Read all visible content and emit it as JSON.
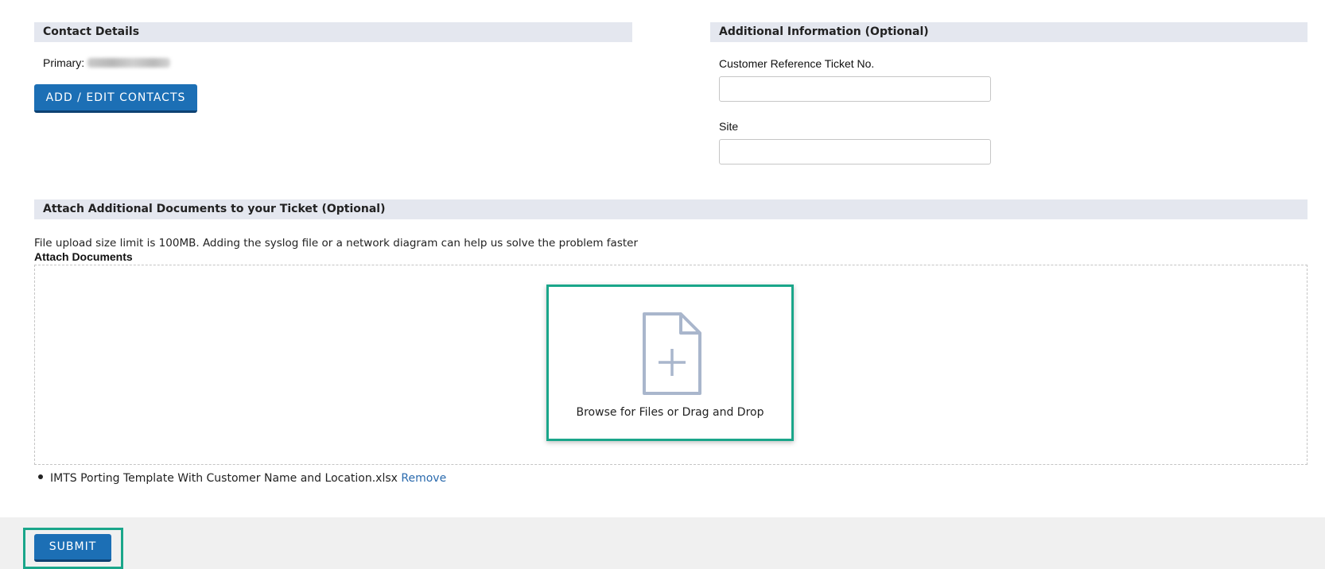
{
  "contact_details": {
    "title": "Contact Details",
    "primary_label": "Primary:",
    "add_edit_button": "ADD / EDIT CONTACTS"
  },
  "additional_info": {
    "title": "Additional Information (Optional)",
    "customer_ref_label": "Customer Reference Ticket No.",
    "customer_ref_value": "",
    "site_label": "Site",
    "site_value": ""
  },
  "attachments": {
    "title": "Attach Additional Documents to your Ticket (Optional)",
    "size_note": "File upload size limit is 100MB. Adding the syslog file or a network diagram can help us solve the problem faster",
    "attach_label": "Attach Documents",
    "browse_label": "Browse for Files or Drag and Drop",
    "files": [
      {
        "name": "IMTS Porting Template With Customer Name and Location.xlsx",
        "remove_label": "Remove"
      }
    ]
  },
  "footer": {
    "submit_button": "SUBMIT"
  },
  "colors": {
    "section_header_bg": "#e4e7ef",
    "button_bg": "#1c6fb5",
    "highlight_border": "#1aa68a",
    "link": "#2a6aad",
    "icon": "#a9b6cc"
  },
  "icons": {
    "file_add": "file-plus-icon"
  }
}
